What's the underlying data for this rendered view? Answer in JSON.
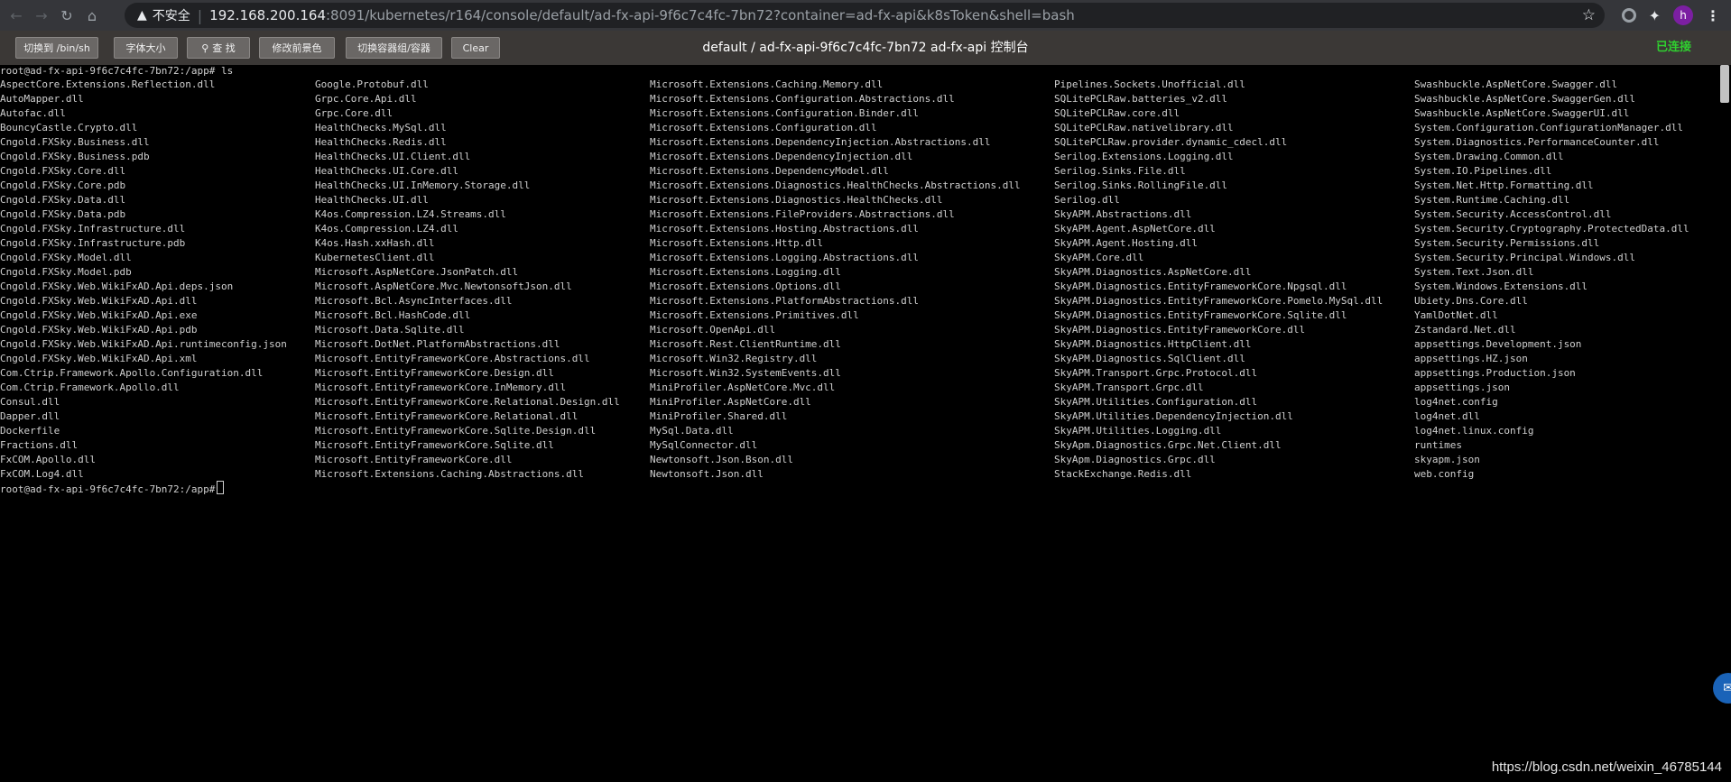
{
  "browser": {
    "back_icon": "arrow-left-icon",
    "insecure_label": "不安全",
    "url_host": "192.168.200.164",
    "url_rest": ":8091/kubernetes/r164/console/default/ad-fx-api-9f6c7c4fc-7bn72?container=ad-fx-api&k8sToken&shell=bash",
    "avatar_letter": "h"
  },
  "toolbar": {
    "buttons": [
      "切换到 /bin/sh",
      "字体大小",
      "查 找",
      "修改前景色",
      "切换容器组/容器",
      "Clear"
    ],
    "title": "default / ad-fx-api-9f6c7c4fc-7bn72 ad-fx-api 控制台",
    "status": "已连接",
    "status_color": "#2fd02f"
  },
  "terminal": {
    "prompt_command": "root@ad-fx-api-9f6c7c4fc-7bn72:/app# ls",
    "prompt_end": "root@ad-fx-api-9f6c7c4fc-7bn72:/app#",
    "columns": [
      [
        "AspectCore.Extensions.Reflection.dll",
        "AutoMapper.dll",
        "Autofac.dll",
        "BouncyCastle.Crypto.dll",
        "Cngold.FXSky.Business.dll",
        "Cngold.FXSky.Business.pdb",
        "Cngold.FXSky.Core.dll",
        "Cngold.FXSky.Core.pdb",
        "Cngold.FXSky.Data.dll",
        "Cngold.FXSky.Data.pdb",
        "Cngold.FXSky.Infrastructure.dll",
        "Cngold.FXSky.Infrastructure.pdb",
        "Cngold.FXSky.Model.dll",
        "Cngold.FXSky.Model.pdb",
        "Cngold.FXSky.Web.WikiFxAD.Api.deps.json",
        "Cngold.FXSky.Web.WikiFxAD.Api.dll",
        "Cngold.FXSky.Web.WikiFxAD.Api.exe",
        "Cngold.FXSky.Web.WikiFxAD.Api.pdb",
        "Cngold.FXSky.Web.WikiFxAD.Api.runtimeconfig.json",
        "Cngold.FXSky.Web.WikiFxAD.Api.xml",
        "Com.Ctrip.Framework.Apollo.Configuration.dll",
        "Com.Ctrip.Framework.Apollo.dll",
        "Consul.dll",
        "Dapper.dll",
        "Dockerfile",
        "Fractions.dll",
        "FxCOM.Apollo.dll",
        "FxCOM.Log4.dll"
      ],
      [
        "Google.Protobuf.dll",
        "Grpc.Core.Api.dll",
        "Grpc.Core.dll",
        "HealthChecks.MySql.dll",
        "HealthChecks.Redis.dll",
        "HealthChecks.UI.Client.dll",
        "HealthChecks.UI.Core.dll",
        "HealthChecks.UI.InMemory.Storage.dll",
        "HealthChecks.UI.dll",
        "K4os.Compression.LZ4.Streams.dll",
        "K4os.Compression.LZ4.dll",
        "K4os.Hash.xxHash.dll",
        "KubernetesClient.dll",
        "Microsoft.AspNetCore.JsonPatch.dll",
        "Microsoft.AspNetCore.Mvc.NewtonsoftJson.dll",
        "Microsoft.Bcl.AsyncInterfaces.dll",
        "Microsoft.Bcl.HashCode.dll",
        "Microsoft.Data.Sqlite.dll",
        "Microsoft.DotNet.PlatformAbstractions.dll",
        "Microsoft.EntityFrameworkCore.Abstractions.dll",
        "Microsoft.EntityFrameworkCore.Design.dll",
        "Microsoft.EntityFrameworkCore.InMemory.dll",
        "Microsoft.EntityFrameworkCore.Relational.Design.dll",
        "Microsoft.EntityFrameworkCore.Relational.dll",
        "Microsoft.EntityFrameworkCore.Sqlite.Design.dll",
        "Microsoft.EntityFrameworkCore.Sqlite.dll",
        "Microsoft.EntityFrameworkCore.dll",
        "Microsoft.Extensions.Caching.Abstractions.dll"
      ],
      [
        "Microsoft.Extensions.Caching.Memory.dll",
        "Microsoft.Extensions.Configuration.Abstractions.dll",
        "Microsoft.Extensions.Configuration.Binder.dll",
        "Microsoft.Extensions.Configuration.dll",
        "Microsoft.Extensions.DependencyInjection.Abstractions.dll",
        "Microsoft.Extensions.DependencyInjection.dll",
        "Microsoft.Extensions.DependencyModel.dll",
        "Microsoft.Extensions.Diagnostics.HealthChecks.Abstractions.dll",
        "Microsoft.Extensions.Diagnostics.HealthChecks.dll",
        "Microsoft.Extensions.FileProviders.Abstractions.dll",
        "Microsoft.Extensions.Hosting.Abstractions.dll",
        "Microsoft.Extensions.Http.dll",
        "Microsoft.Extensions.Logging.Abstractions.dll",
        "Microsoft.Extensions.Logging.dll",
        "Microsoft.Extensions.Options.dll",
        "Microsoft.Extensions.PlatformAbstractions.dll",
        "Microsoft.Extensions.Primitives.dll",
        "Microsoft.OpenApi.dll",
        "Microsoft.Rest.ClientRuntime.dll",
        "Microsoft.Win32.Registry.dll",
        "Microsoft.Win32.SystemEvents.dll",
        "MiniProfiler.AspNetCore.Mvc.dll",
        "MiniProfiler.AspNetCore.dll",
        "MiniProfiler.Shared.dll",
        "MySql.Data.dll",
        "MySqlConnector.dll",
        "Newtonsoft.Json.Bson.dll",
        "Newtonsoft.Json.dll"
      ],
      [
        "Pipelines.Sockets.Unofficial.dll",
        "SQLitePCLRaw.batteries_v2.dll",
        "SQLitePCLRaw.core.dll",
        "SQLitePCLRaw.nativelibrary.dll",
        "SQLitePCLRaw.provider.dynamic_cdecl.dll",
        "Serilog.Extensions.Logging.dll",
        "Serilog.Sinks.File.dll",
        "Serilog.Sinks.RollingFile.dll",
        "Serilog.dll",
        "SkyAPM.Abstractions.dll",
        "SkyAPM.Agent.AspNetCore.dll",
        "SkyAPM.Agent.Hosting.dll",
        "SkyAPM.Core.dll",
        "SkyAPM.Diagnostics.AspNetCore.dll",
        "SkyAPM.Diagnostics.EntityFrameworkCore.Npgsql.dll",
        "SkyAPM.Diagnostics.EntityFrameworkCore.Pomelo.MySql.dll",
        "SkyAPM.Diagnostics.EntityFrameworkCore.Sqlite.dll",
        "SkyAPM.Diagnostics.EntityFrameworkCore.dll",
        "SkyAPM.Diagnostics.HttpClient.dll",
        "SkyAPM.Diagnostics.SqlClient.dll",
        "SkyAPM.Transport.Grpc.Protocol.dll",
        "SkyAPM.Transport.Grpc.dll",
        "SkyAPM.Utilities.Configuration.dll",
        "SkyAPM.Utilities.DependencyInjection.dll",
        "SkyAPM.Utilities.Logging.dll",
        "SkyApm.Diagnostics.Grpc.Net.Client.dll",
        "SkyApm.Diagnostics.Grpc.dll",
        "StackExchange.Redis.dll"
      ],
      [
        "Swashbuckle.AspNetCore.Swagger.dll",
        "Swashbuckle.AspNetCore.SwaggerGen.dll",
        "Swashbuckle.AspNetCore.SwaggerUI.dll",
        "System.Configuration.ConfigurationManager.dll",
        "System.Diagnostics.PerformanceCounter.dll",
        "System.Drawing.Common.dll",
        "System.IO.Pipelines.dll",
        "System.Net.Http.Formatting.dll",
        "System.Runtime.Caching.dll",
        "System.Security.AccessControl.dll",
        "System.Security.Cryptography.ProtectedData.dll",
        "System.Security.Permissions.dll",
        "System.Security.Principal.Windows.dll",
        "System.Text.Json.dll",
        "System.Windows.Extensions.dll",
        "Ubiety.Dns.Core.dll",
        "YamlDotNet.dll",
        "Zstandard.Net.dll",
        "appsettings.Development.json",
        "appsettings.HZ.json",
        "appsettings.Production.json",
        "appsettings.json",
        "log4net.config",
        "log4net.dll",
        "log4net.linux.config",
        "runtimes",
        "skyapm.json",
        "web.config"
      ]
    ]
  },
  "watermark": "https://blog.csdn.net/weixin_46785144"
}
